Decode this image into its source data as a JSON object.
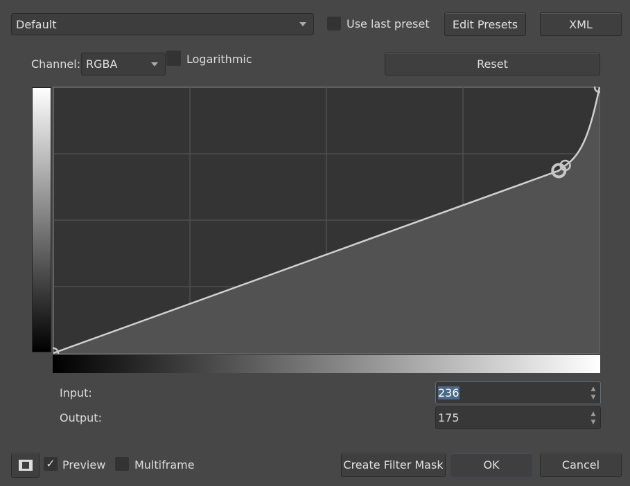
{
  "preset": {
    "value": "Default",
    "use_last_preset": "Use last preset",
    "edit_presets": "Edit Presets",
    "xml": "XML"
  },
  "channel": {
    "label": "Channel:",
    "value": "RGBA",
    "logarithmic": "Logarithmic",
    "reset": "Reset"
  },
  "io": {
    "input_label": "Input:",
    "input_value": "236",
    "output_label": "Output:",
    "output_value": "175"
  },
  "footer": {
    "preview": "Preview",
    "preview_checked": true,
    "multiframe": "Multiframe",
    "create_filter_mask": "Create Filter Mask",
    "ok": "OK",
    "cancel": "Cancel"
  },
  "chart_data": {
    "type": "line",
    "title": "",
    "xlim": [
      0,
      255
    ],
    "ylim": [
      0,
      255
    ],
    "grid": true,
    "points": [
      [
        0,
        0
      ],
      [
        236,
        175
      ],
      [
        239,
        180
      ],
      [
        255,
        255
      ]
    ],
    "selected_point": 1
  }
}
